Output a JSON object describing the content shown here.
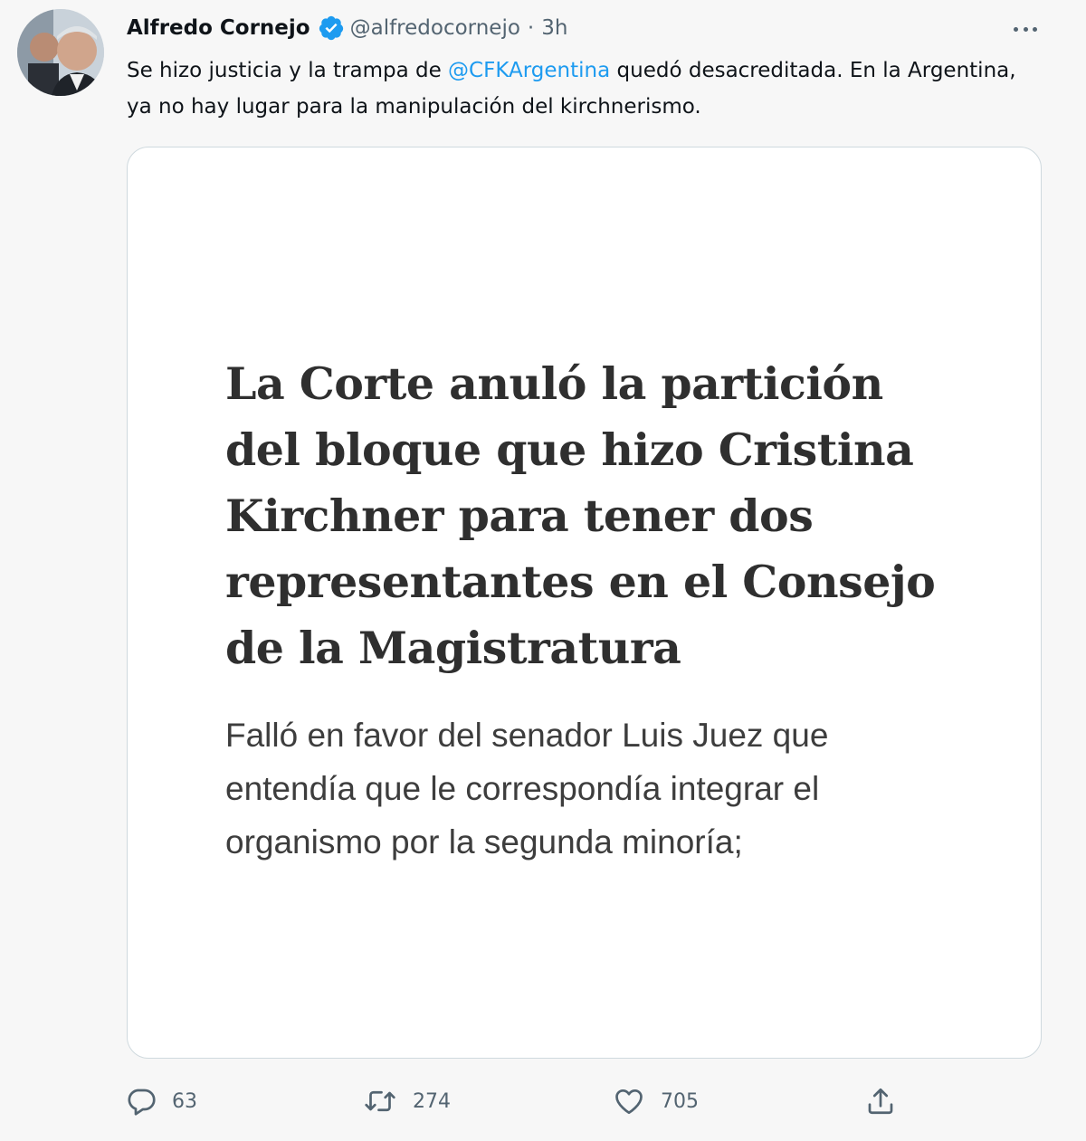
{
  "tweet": {
    "author": {
      "display_name": "Alfredo Cornejo",
      "handle": "@alfredocornejo",
      "verified": true,
      "avatar": "profile-photo"
    },
    "separator": "·",
    "time": "3h",
    "text_before": "Se hizo justicia y la trampa de ",
    "mention": "@CFKArgentina",
    "text_after": " quedó desacreditada. En la Argentina, ya no hay lugar para la manipulación del kirchnerismo.",
    "card": {
      "headline": "La Corte anuló la partición del bloque que hizo Cristina Kirchner para tener dos representantes en el Consejo de la Magistratura",
      "summary": "Falló en favor del senador Luis Juez que entendía que le correspondía integrar el organismo por la segunda minoría;"
    },
    "actions": {
      "reply": {
        "icon": "reply-icon",
        "count": "63"
      },
      "retweet": {
        "icon": "retweet-icon",
        "count": "274"
      },
      "like": {
        "icon": "heart-icon",
        "count": "705"
      },
      "share": {
        "icon": "share-icon"
      }
    }
  },
  "colors": {
    "background": "#f7f7f7",
    "text": "#0f1419",
    "secondary_text": "#536471",
    "accent": "#1d9bf0",
    "card_border": "#cfd9de"
  }
}
